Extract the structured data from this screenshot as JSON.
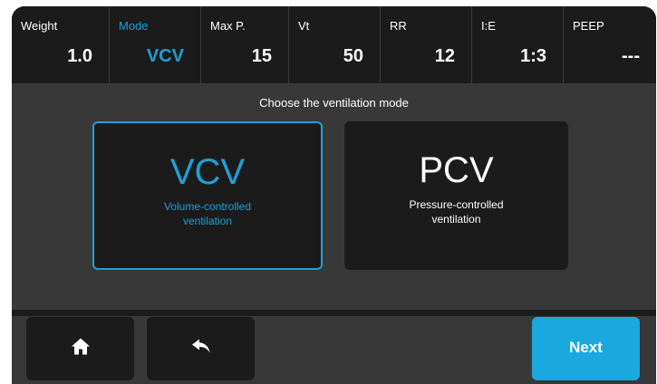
{
  "params": [
    {
      "label": "Weight",
      "value": "1.0"
    },
    {
      "label": "Mode",
      "value": "VCV"
    },
    {
      "label": "Max P.",
      "value": "15"
    },
    {
      "label": "Vt",
      "value": "50"
    },
    {
      "label": "RR",
      "value": "12"
    },
    {
      "label": "I:E",
      "value": "1:3"
    },
    {
      "label": "PEEP",
      "value": "---"
    }
  ],
  "prompt": "Choose the ventilation mode",
  "modes": [
    {
      "code": "VCV",
      "description": "Volume-controlled ventilation",
      "selected": true
    },
    {
      "code": "PCV",
      "description": "Pressure-controlled ventilation",
      "selected": false
    }
  ],
  "footer": {
    "home_icon": "home-icon",
    "back_icon": "back-arrow-icon",
    "next_label": "Next"
  },
  "colors": {
    "accent": "#1e9fd8",
    "next_button": "#1ba8df",
    "panel": "#1b1b1b",
    "background": "#383838",
    "text": "#ffffff"
  }
}
